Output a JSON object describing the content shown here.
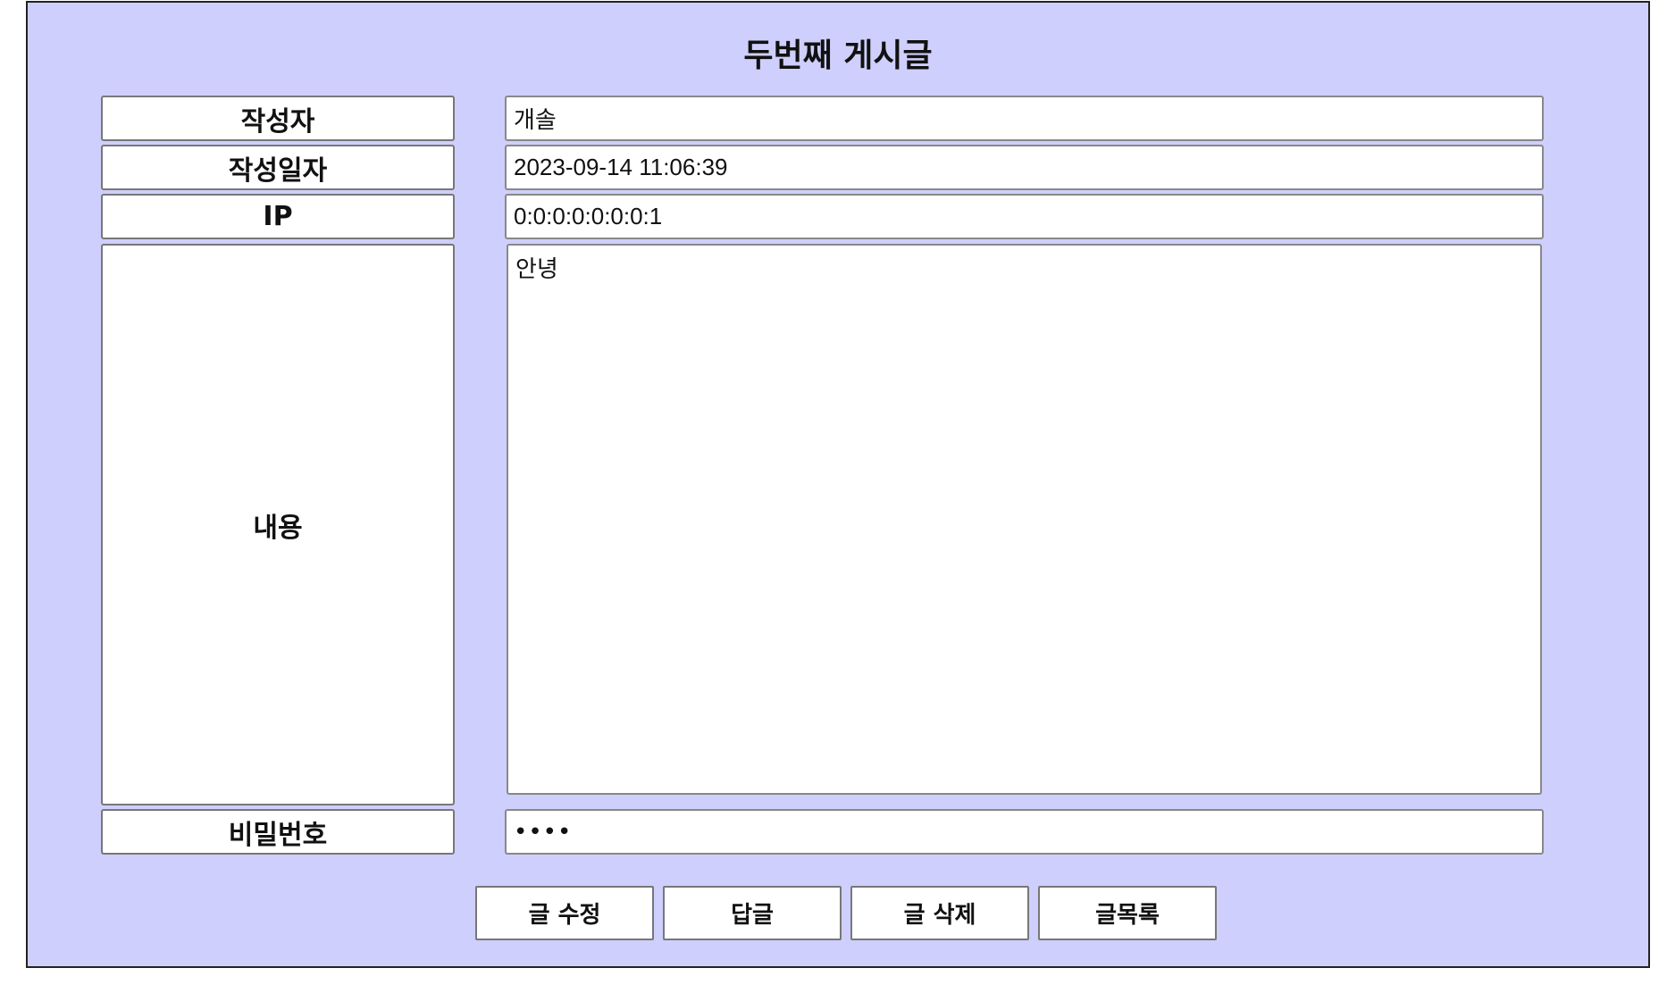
{
  "page": {
    "title": "두번째 게시글"
  },
  "form": {
    "author_label": "작성자",
    "author_value": "개솔",
    "date_label": "작성일자",
    "date_value": "2023-09-14 11:06:39",
    "ip_label": "IP",
    "ip_value": "0:0:0:0:0:0:0:1",
    "content_label": "내용",
    "content_value": "안녕",
    "password_label": "비밀번호",
    "password_value": "••••"
  },
  "buttons": {
    "edit": "글 수정",
    "reply": "답글",
    "delete": "글 삭제",
    "list": "글목록"
  },
  "colors": {
    "panel_background": "#cfcffd"
  }
}
